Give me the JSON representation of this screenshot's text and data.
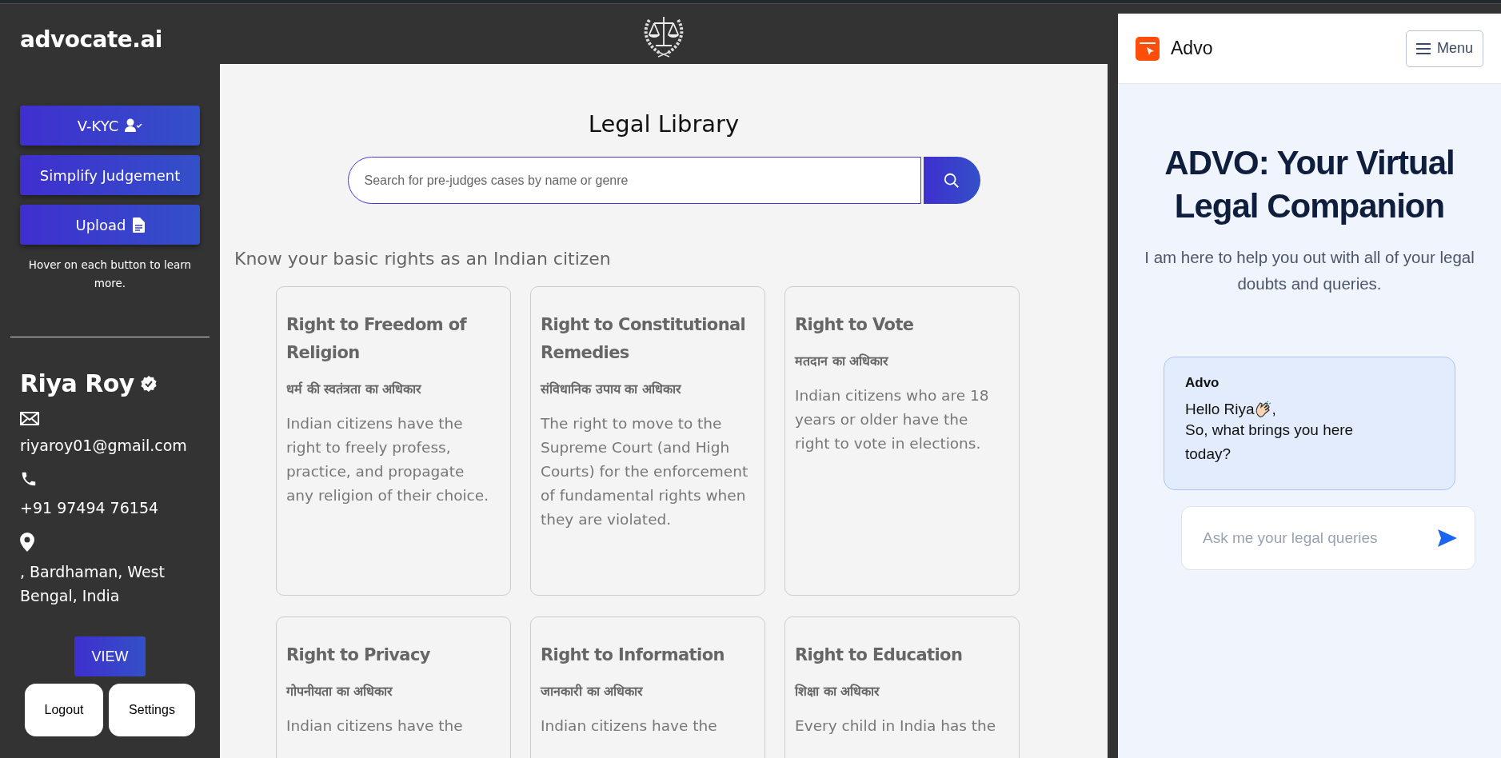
{
  "sidebar": {
    "brand": "advocate.ai",
    "buttons": [
      {
        "label": "V-KYC",
        "kind": "kyc"
      },
      {
        "label": "Simplify Judgement",
        "kind": "plain"
      },
      {
        "label": "Upload",
        "kind": "upload"
      }
    ],
    "hint": "Hover on each button to learn more.",
    "profile": {
      "name": "Riya Roy",
      "verified": true,
      "email": "riyaroy01@gmail.com",
      "phone": "+91 97494 76154",
      "address": ", Bardhaman, West Bengal, India"
    },
    "view_button": "VIEW",
    "footer_buttons": [
      "Logout",
      "Settings"
    ]
  },
  "library": {
    "title": "Legal Library",
    "search": {
      "placeholder": "Search for pre-judges cases by name or genre"
    },
    "heading": "Know your basic rights as an Indian citizen",
    "cards": [
      {
        "title": "Right to Freedom of Religion",
        "subtitle": "धर्म की स्वतंत्रता का अधिकार",
        "text": "Indian citizens have the right to freely profess, practice, and propagate any religion of their choice."
      },
      {
        "title": "Right to Constitutional Remedies",
        "subtitle": "संविधानिक उपाय का अधिकार",
        "text": "The right to move to the Supreme Court (and High Courts) for the enforcement of fundamental rights when they are violated."
      },
      {
        "title": "Right to Vote",
        "subtitle": "मतदान का अधिकार",
        "text": "Indian citizens who are 18 years or older have the right to vote in elections."
      },
      {
        "title": "Right to Privacy",
        "subtitle": "गोपनीयता का अधिकार",
        "text": "Indian citizens have the"
      },
      {
        "title": "Right to Information",
        "subtitle": "जानकारी का अधिकार",
        "text": "Indian citizens have the"
      },
      {
        "title": "Right to Education",
        "subtitle": "शिक्षा का अधिकार",
        "text": "Every child in India has the"
      }
    ]
  },
  "assistant": {
    "brand": "Advo",
    "menu": "Menu",
    "title": "ADVO: Your Virtual Legal Companion",
    "subtitle": "I am here to help you out with all of your legal doubts and queries.",
    "message": {
      "sender": "Advo",
      "greeting": "Hello Riya",
      "greeting_end": ",",
      "text": "So, what brings you here today?"
    },
    "input": {
      "placeholder": "Ask me your legal queries"
    }
  }
}
